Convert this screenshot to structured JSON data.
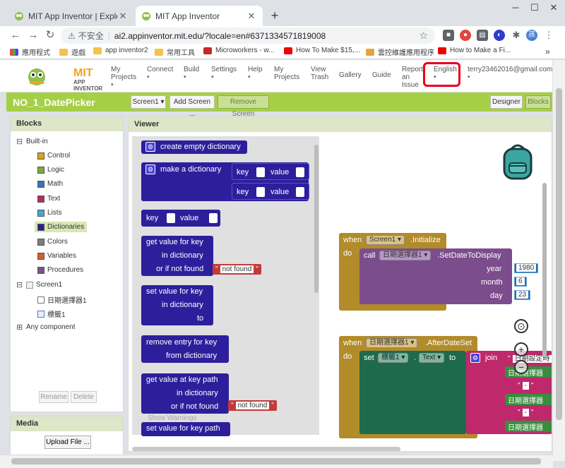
{
  "browser": {
    "tabs": [
      {
        "title": "MIT App Inventor | Explore MIT"
      },
      {
        "title": "MIT App Inventor"
      }
    ],
    "security_label": "不安全",
    "url": "ai2.appinventor.mit.edu/?locale=en#6371334571819008",
    "profile_initial": "孩",
    "bookmarks": [
      "應用程式",
      "遊戲",
      "app inventor2",
      "常用工具",
      "Microworkers - w...",
      "How To Make $15,...",
      "雲控維護應用程序",
      "How to Make a Fi..."
    ],
    "bookmarks_overflow": "»"
  },
  "header": {
    "brand": "MIT",
    "brand_sub": "APP INVENTOR",
    "menu": [
      "My Projects",
      "Connect",
      "Build",
      "Settings",
      "Help",
      "My Projects",
      "View Trash",
      "Gallery",
      "Guide",
      "Report an Issue"
    ],
    "language": "English",
    "account": "terry23462016@gmail.com"
  },
  "project": {
    "name": "NO_1_DatePicker",
    "screen_select": "Screen1 ▾",
    "add_screen": "Add Screen ...",
    "remove_screen": "Remove Screen",
    "designer": "Designer",
    "blocks": "Blocks"
  },
  "blocks_panel": {
    "title": "Blocks",
    "builtin": "Built-in",
    "categories": [
      {
        "label": "Control",
        "color": "#e0a11b"
      },
      {
        "label": "Logic",
        "color": "#77ab41"
      },
      {
        "label": "Math",
        "color": "#3f71b5"
      },
      {
        "label": "Text",
        "color": "#b32d5e"
      },
      {
        "label": "Lists",
        "color": "#49a6d4"
      },
      {
        "label": "Dictionaries",
        "color": "#2d1f9c"
      },
      {
        "label": "Colors",
        "color": "#7d7d7d"
      },
      {
        "label": "Variables",
        "color": "#d05f2d"
      },
      {
        "label": "Procedures",
        "color": "#7c5385"
      }
    ],
    "screen": "Screen1",
    "components": [
      "日期選擇器1",
      "標籤1"
    ],
    "any_component": "Any component",
    "rename": "Rename",
    "delete": "Delete"
  },
  "media_panel": {
    "title": "Media",
    "upload": "Upload File ..."
  },
  "viewer": {
    "title": "Viewer",
    "flyout": {
      "create_empty": "create empty dictionary",
      "make_dict": "make a dictionary",
      "key": "key",
      "value": "value",
      "get_value": "get value for key",
      "in_dictionary": "in dictionary",
      "or_if_not_found": "or if not found",
      "not_found": "not found",
      "set_value": "set value for key",
      "to": "to",
      "remove_entry": "remove entry for key",
      "from_dictionary": "from dictionary",
      "get_at_path": "get value at key path",
      "set_at_path": "set value for key path",
      "show_warnings": "Show Warnings"
    },
    "init_block": {
      "when": "when",
      "component": "Screen1 ▾",
      "event": ".Initialize",
      "do": "do",
      "call": "call",
      "target": "日期選擇器1 ▾",
      "method": ".SetDateToDisplay",
      "year_label": "year",
      "year": "1980",
      "month_label": "month",
      "month": "6",
      "day_label": "day",
      "day": "23"
    },
    "after_block": {
      "when": "when",
      "component": "日期選擇器1 ▾",
      "event": ".AfterDateSet",
      "do": "do",
      "set": "set",
      "target": "標籤1 ▾",
      "prop": "Text ▾",
      "to": "to",
      "join": "join",
      "parts": [
        "日期設定時",
        "日期選擇器",
        "-",
        "日期選擇器",
        "-",
        "日期選擇器"
      ]
    }
  }
}
